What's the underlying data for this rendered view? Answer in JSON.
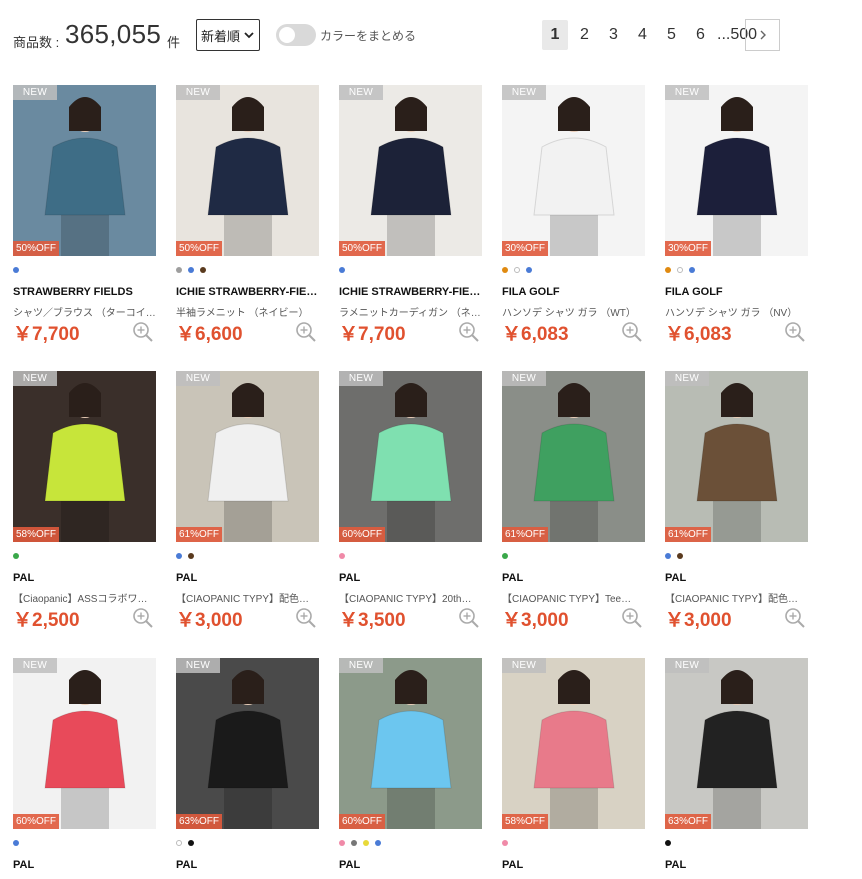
{
  "header": {
    "count_label": "商品数 :",
    "count_value": "365,055",
    "count_unit": "件",
    "sort_selected": "新着順",
    "toggle_label": "カラーをまとめる",
    "pages": [
      "1",
      "2",
      "3",
      "4",
      "5",
      "6",
      "...500"
    ],
    "active_page": "1"
  },
  "colors": {
    "price": "#e0512f",
    "accent_off": "#e0512f"
  },
  "products": [
    {
      "new_label": "NEW",
      "discount": "50%OFF",
      "colors": [
        "#4a7bd6"
      ],
      "brand": "STRAWBERRY FIELDS",
      "name": "シャツ／ブラウス （ターコイ…",
      "price": "￥7,700",
      "bg": "#6a8aa0",
      "fg": "#3e6d86"
    },
    {
      "new_label": "NEW",
      "discount": "50%OFF",
      "colors": [
        "#9e9e9e",
        "#4a7bd6",
        "#5a3a1e"
      ],
      "brand": "ICHIE STRAWBERRY-FIE…",
      "name": "半袖ラメニット （ネイビー）",
      "price": "￥6,600",
      "bg": "#e8e4de",
      "fg": "#1f2a44"
    },
    {
      "new_label": "NEW",
      "discount": "50%OFF",
      "colors": [
        "#4a7bd6"
      ],
      "brand": "ICHIE STRAWBERRY-FIE…",
      "name": "ラメニットカーディガン （ネ…",
      "price": "￥7,700",
      "bg": "#eceae6",
      "fg": "#1c2238"
    },
    {
      "new_label": "NEW",
      "discount": "30%OFF",
      "colors": [
        "#e08a10",
        "#ffffff",
        "#4a7bd6"
      ],
      "brand": "FILA GOLF",
      "name": "ハンソデ シャツ ガラ （WT）",
      "price": "￥6,083",
      "bg": "#f4f4f4",
      "fg": "#f2f2f2"
    },
    {
      "new_label": "NEW",
      "discount": "30%OFF",
      "colors": [
        "#e08a10",
        "#ffffff",
        "#4a7bd6"
      ],
      "brand": "FILA GOLF",
      "name": "ハンソデ シャツ ガラ （NV）",
      "price": "￥6,083",
      "bg": "#f4f4f4",
      "fg": "#1c1f3a"
    },
    {
      "new_label": "NEW",
      "discount": "58%OFF",
      "colors": [
        "#3aa84a"
      ],
      "brand": "PAL",
      "name": "【Ciaopanic】ASSコラボワ…",
      "price": "￥2,500",
      "bg": "#3a2f2a",
      "fg": "#c7e53a"
    },
    {
      "new_label": "NEW",
      "discount": "61%OFF",
      "colors": [
        "#4a7bd6",
        "#5a3a1e"
      ],
      "brand": "PAL",
      "name": "【CIAOPANIC TYPY】配色…",
      "price": "￥3,000",
      "bg": "#c9c4b8",
      "fg": "#f0f0f0"
    },
    {
      "new_label": "NEW",
      "discount": "60%OFF",
      "colors": [
        "#f08aa8"
      ],
      "brand": "PAL",
      "name": "【CIAOPANIC TYPY】20th…",
      "price": "￥3,500",
      "bg": "#6e6e6c",
      "fg": "#7fe0b0"
    },
    {
      "new_label": "NEW",
      "discount": "61%OFF",
      "colors": [
        "#3aa84a"
      ],
      "brand": "PAL",
      "name": "【CIAOPANIC TYPY】Tee…",
      "price": "￥3,000",
      "bg": "#8a8e88",
      "fg": "#3fa060"
    },
    {
      "new_label": "NEW",
      "discount": "61%OFF",
      "colors": [
        "#4a7bd6",
        "#5a3a1e"
      ],
      "brand": "PAL",
      "name": "【CIAOPANIC TYPY】配色…",
      "price": "￥3,000",
      "bg": "#b8bcb4",
      "fg": "#6b5038"
    },
    {
      "new_label": "NEW",
      "discount": "60%OFF",
      "colors": [
        "#4a7bd6"
      ],
      "brand": "PAL",
      "name": "",
      "price": "",
      "bg": "#f2f2f2",
      "fg": "#e84a5a"
    },
    {
      "new_label": "NEW",
      "discount": "63%OFF",
      "colors": [
        "#ffffff",
        "#111111"
      ],
      "brand": "PAL",
      "name": "",
      "price": "",
      "bg": "#4a4a4a",
      "fg": "#1a1a1a"
    },
    {
      "new_label": "NEW",
      "discount": "60%OFF",
      "colors": [
        "#f08aa8",
        "#777777",
        "#e8d93a",
        "#4a7bd6"
      ],
      "brand": "PAL",
      "name": "",
      "price": "",
      "bg": "#8c9a8a",
      "fg": "#6cc6ef"
    },
    {
      "new_label": "NEW",
      "discount": "58%OFF",
      "colors": [
        "#f08aa8"
      ],
      "brand": "PAL",
      "name": "",
      "price": "",
      "bg": "#d8d2c4",
      "fg": "#e87a8a"
    },
    {
      "new_label": "NEW",
      "discount": "63%OFF",
      "colors": [
        "#111111"
      ],
      "brand": "PAL",
      "name": "",
      "price": "",
      "bg": "#c8c8c4",
      "fg": "#222222"
    }
  ]
}
